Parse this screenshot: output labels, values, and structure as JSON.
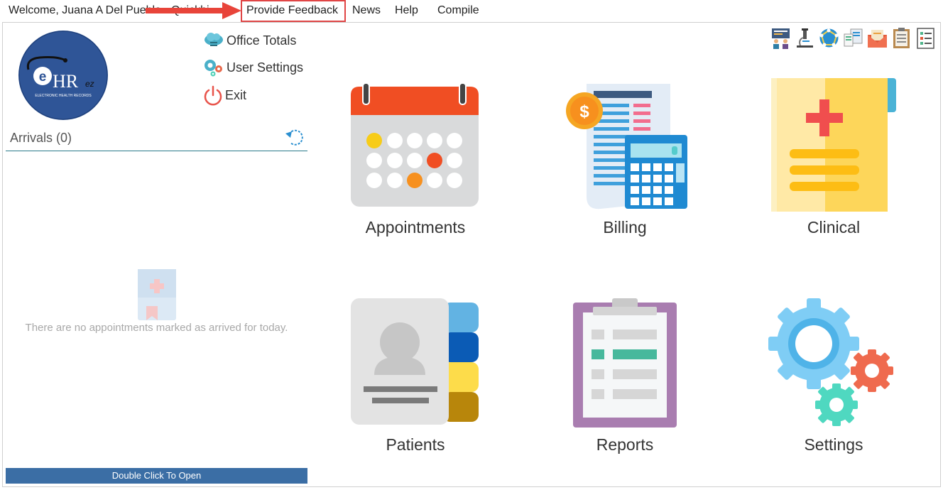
{
  "menu": {
    "welcome": "Welcome, Juana A Del Pueblo - Quickbi",
    "provide_feedback": "Provide Feedback",
    "news": "News",
    "help": "Help",
    "compile": "Compile"
  },
  "quick_links": {
    "office_totals": "Office Totals",
    "user_settings": "User Settings",
    "exit": "Exit"
  },
  "logo": {
    "brand": "HR",
    "suffix": "ez",
    "tagline": "ELECTRONIC HEALTH RECORDS"
  },
  "arrivals": {
    "title": "Arrivals (0)",
    "empty_message": "There are no appointments marked as arrived for today.",
    "open_button": "Double Click To Open"
  },
  "tiles": {
    "appointments": "Appointments",
    "billing": "Billing",
    "clinical": "Clinical",
    "patients": "Patients",
    "reports": "Reports",
    "settings": "Settings"
  },
  "colors": {
    "feedback_highlight": "#e04545",
    "open_bar": "#3b6ea5",
    "arrivals_divider": "#2a7a8a"
  }
}
